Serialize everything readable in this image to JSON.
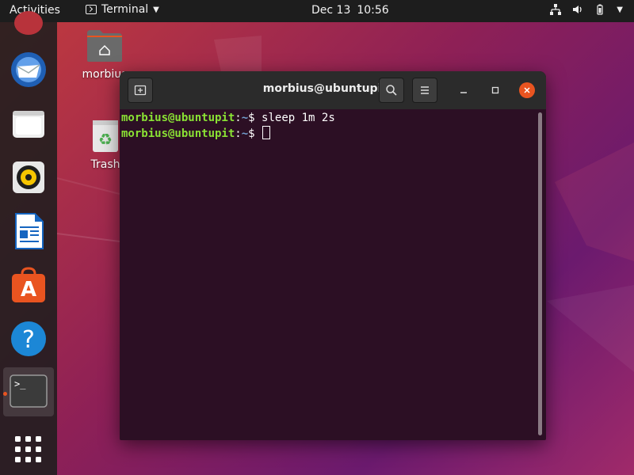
{
  "topbar": {
    "activities": "Activities",
    "app_name": "Terminal",
    "date": "Dec 13",
    "time": "10:56"
  },
  "dock": {
    "items": [
      "thunderbird-icon",
      "files-icon",
      "rhythmbox-icon",
      "libreoffice-writer-icon",
      "software-center-icon",
      "help-icon",
      "terminal-icon",
      "show-apps-icon"
    ],
    "active": "terminal-icon"
  },
  "desktop": {
    "home_label": "morbius",
    "trash_label": "Trash"
  },
  "window": {
    "title": "morbius@ubuntupit: ~"
  },
  "terminal": {
    "lines": [
      {
        "user": "morbius@ubuntupit",
        "path": "~",
        "symbol": "$",
        "command": " sleep 1m 2s"
      },
      {
        "user": "morbius@ubuntupit",
        "path": "~",
        "symbol": "$",
        "command": " "
      }
    ]
  },
  "colors": {
    "accent": "#e95420",
    "prompt_user": "#8ae234",
    "prompt_path": "#729fcf",
    "terminal_bg": "#2c0f24"
  }
}
